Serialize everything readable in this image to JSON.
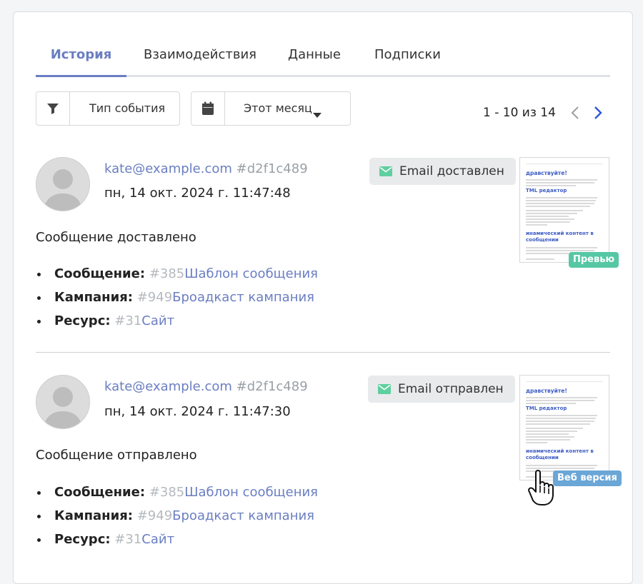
{
  "tabs": [
    {
      "label": "История",
      "active": true
    },
    {
      "label": "Взаимодействия",
      "active": false
    },
    {
      "label": "Данные",
      "active": false
    },
    {
      "label": "Подписки",
      "active": false
    }
  ],
  "filters": {
    "event_type_label": "Тип события",
    "period_label": "Этот месяц"
  },
  "pager": {
    "text": "1 - 10 из 14"
  },
  "events": [
    {
      "email": "kate@example.com",
      "contact_id": "#d2f1c489",
      "datetime": "пн, 14 окт. 2024 г. 11:47:48",
      "status": "Email доставлен",
      "message": "Сообщение доставлено",
      "details": [
        {
          "key": "Сообщение:",
          "num": "#385",
          "value": "Шаблон сообщения"
        },
        {
          "key": "Кампания:",
          "num": "#949",
          "value": "Броадкаст кампания"
        },
        {
          "key": "Ресурс:",
          "num": "#31",
          "value": "Сайт"
        }
      ],
      "thumb": {
        "greeting": "дравствуйте!",
        "heading1": "TML редактор",
        "heading2": "инамический контент в сообщении"
      },
      "tag": "Превью"
    },
    {
      "email": "kate@example.com",
      "contact_id": "#d2f1c489",
      "datetime": "пн, 14 окт. 2024 г. 11:47:30",
      "status": "Email отправлен",
      "message": "Сообщение отправлено",
      "details": [
        {
          "key": "Сообщение:",
          "num": "#385",
          "value": "Шаблон сообщения"
        },
        {
          "key": "Кампания:",
          "num": "#949",
          "value": "Броадкаст кампания"
        },
        {
          "key": "Ресурс:",
          "num": "#31",
          "value": "Сайт"
        }
      ],
      "thumb": {
        "greeting": "дравствуйте!",
        "heading1": "TML редактор",
        "heading2": "инамический контент в сообщении"
      },
      "tag": "Веб версия"
    }
  ],
  "colors": {
    "accent": "#6a7ec2",
    "email_icon": "#5fcf9f",
    "tag_preview": "#56c7a4",
    "tag_webversion": "#6aa6d6"
  }
}
